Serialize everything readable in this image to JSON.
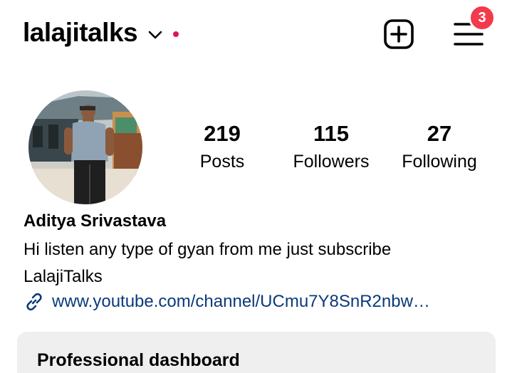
{
  "header": {
    "username": "lalajitalks",
    "notification_count": "3"
  },
  "profile": {
    "stats": [
      {
        "value": "219",
        "label": "Posts"
      },
      {
        "value": "115",
        "label": "Followers"
      },
      {
        "value": "27",
        "label": "Following"
      }
    ],
    "full_name": "Aditya Srivastava",
    "bio_line1": "Hi listen any type of gyan from me just subscribe",
    "bio_line2": "LalajiTalks",
    "link": "www.youtube.com/channel/UCmu7Y8SnR2nbw…"
  },
  "dashboard": {
    "title": "Professional dashboard"
  },
  "colors": {
    "status_dot": "#e4154d",
    "badge": "#f33a4a",
    "link": "#0a3a7a",
    "card_bg": "#efefef"
  }
}
